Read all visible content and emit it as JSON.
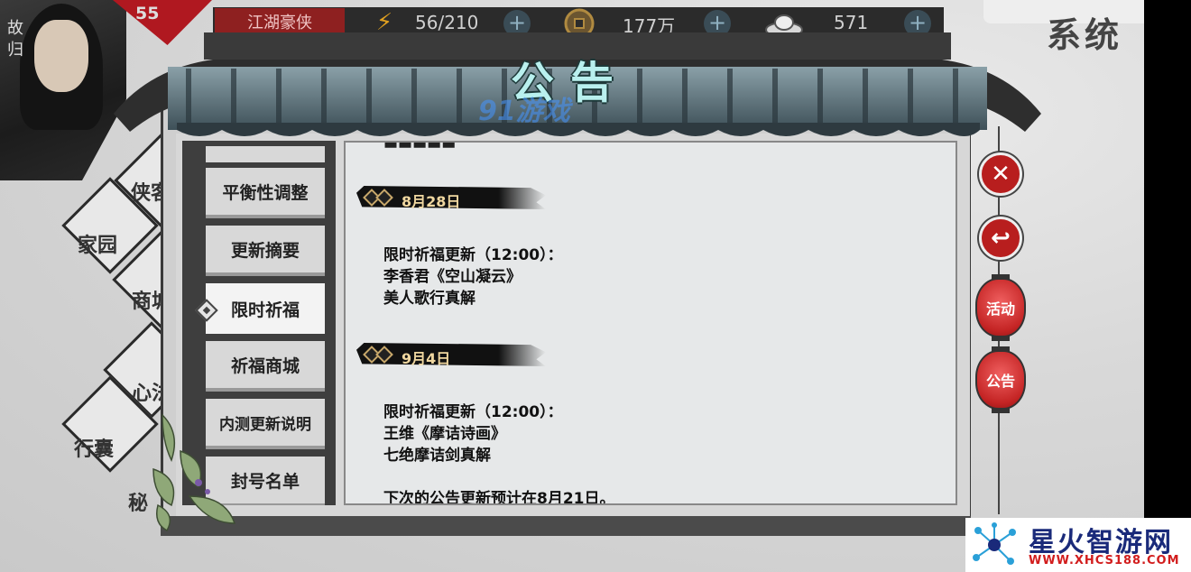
{
  "player": {
    "side_text": "故归",
    "level": "55",
    "title": "江湖豪侠"
  },
  "resources": [
    {
      "icon": "lightning-icon",
      "value": "56/210"
    },
    {
      "icon": "coin-icon",
      "value": "177万"
    },
    {
      "icon": "gold-ingot-icon",
      "value": "571"
    }
  ],
  "system_label": "系统",
  "background_labels": [
    "侠客",
    "家园",
    "商城",
    "心法",
    "行囊",
    "秘"
  ],
  "panel": {
    "title": "公告",
    "watermark": "91游戏"
  },
  "tabs": [
    {
      "label": "平衡性调整",
      "active": false
    },
    {
      "label": "更新摘要",
      "active": false
    },
    {
      "label": "限时祈福",
      "active": true
    },
    {
      "label": "祈福商城",
      "active": false
    },
    {
      "label": "内测更新说明",
      "active": false
    },
    {
      "label": "封号名单",
      "active": false
    }
  ],
  "content": {
    "sections": [
      {
        "date": "8月28日",
        "lines": [
          "限时祈福更新（12:00）：",
          "李香君《空山凝云》",
          "美人歌行真解"
        ]
      },
      {
        "date": "9月4日",
        "lines": [
          "限时祈福更新（12:00）：",
          "王维《摩诘诗画》",
          "七绝摩诘剑真解"
        ]
      }
    ],
    "footer": "下次的公告更新预计在8月21日。"
  },
  "side_buttons": {
    "close": "✕",
    "back": "↩",
    "activity": "活动",
    "notice": "公告"
  },
  "site_watermark": {
    "title": "星火智游网",
    "url": "WWW.XHCS188.COM"
  },
  "colors": {
    "accent_red": "#b81e1e",
    "title_cyan": "#b9f0ee",
    "date_gold": "#f0d7a0"
  }
}
